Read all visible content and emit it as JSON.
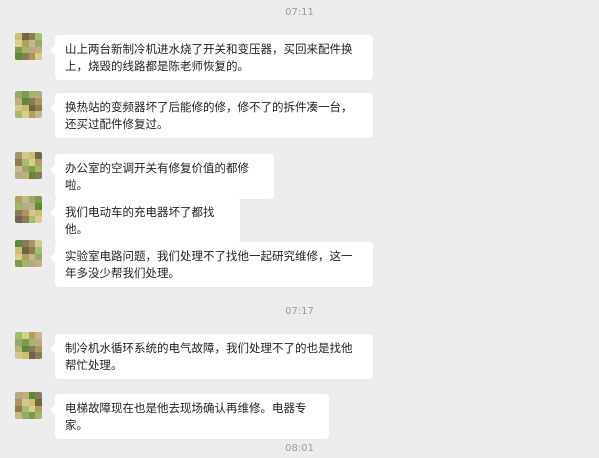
{
  "timestamps": [
    "07:11",
    "07:17",
    "08:01"
  ],
  "messages": [
    {
      "text": "山上两台新制冷机进水烧了开关和变压器，买回来配件换上，烧毁的线路都是陈老师恢复的。"
    },
    {
      "text": "换热站的变频器坏了后能修的修，修不了的拆件凑一台，还买过配件修复过。"
    },
    {
      "text": "办公室的空调开关有修复价值的都修啦。"
    },
    {
      "text": "我们电动车的充电器坏了都找他。"
    },
    {
      "text": "实验室电路问题，我们处理不了找他一起研究维修，这一年多没少帮我们处理。"
    },
    {
      "text": "制冷机水循环系统的电气故障，我们处理不了的也是找他帮忙处理。"
    },
    {
      "text": "电梯故障现在也是他去现场确认再维修。电器专家。"
    }
  ],
  "avatar": {
    "icon": "blurred-avatar-icon",
    "colors": [
      "#c9c070",
      "#8a7a5a",
      "#b6a88a",
      "#9aa870",
      "#d8cf8a",
      "#6f6548",
      "#a8955f",
      "#c2b07a",
      "#7f9a4a",
      "#b0a060",
      "#8f7b55",
      "#d4c890",
      "#5e8a3a",
      "#9fb868",
      "#c8b884",
      "#a0c070"
    ]
  },
  "colors": {
    "background": "#ededed",
    "bubble": "#ffffff",
    "text": "#1f1f1f",
    "timestamp": "#9b9b9b"
  }
}
